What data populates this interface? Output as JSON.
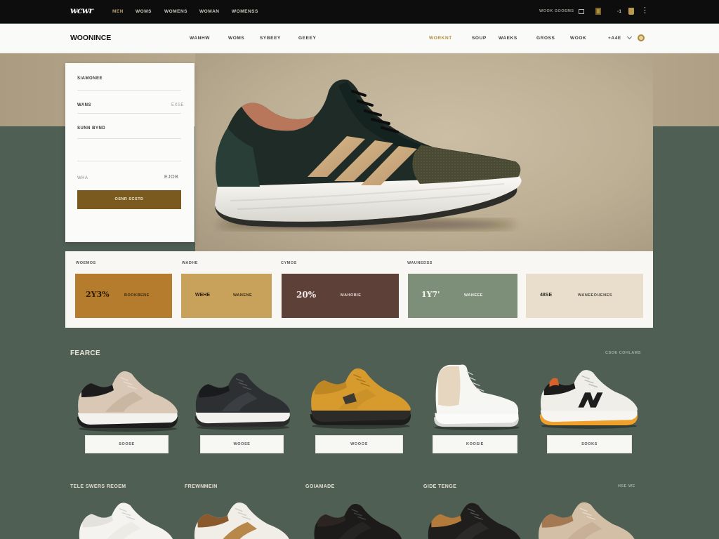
{
  "theme": {
    "topbar_bg": "#0d0d0d",
    "header_bg": "#fafaf8",
    "page_bg": "#4f5f54",
    "accent_gold": "#b08a3a",
    "form_button": "#7a5a1e"
  },
  "topbar": {
    "logo": "wcwr",
    "nav": [
      "MEN",
      "WOMS",
      "WOMENS",
      "WOMAN",
      "WOMENSS"
    ],
    "account_text": "WOOK GOOEMS",
    "cart_count": "-1",
    "icons": [
      "grid-icon",
      "tag-icon",
      "bag-icon",
      "more-icon"
    ]
  },
  "header": {
    "brand": "WOONINCE",
    "nav": [
      "WANHW",
      "WOMS",
      "SYBEEY",
      "GEEEY"
    ],
    "right_nav": [
      "WORKNT",
      "SOUP",
      "WAEKS",
      "GROSS",
      "WOOK"
    ],
    "account": "+A4E",
    "icons": [
      "chevron-down-icon",
      "user-icon"
    ]
  },
  "form": {
    "fields": [
      {
        "label": "SIAMONEE"
      },
      {
        "label": "WANS",
        "hint": "EXSE"
      },
      {
        "label": "SUNN BYND"
      },
      {
        "label": "WHA",
        "hint": "EJOB"
      }
    ],
    "button": "OSNR SCSTD"
  },
  "swatches": {
    "headers": [
      "WOEMOS",
      "WADHE",
      "CYMOS",
      "WAUNEDSS"
    ],
    "items": [
      {
        "value": "2Y3%",
        "name": "BOOKBENE",
        "color": "#b57c2d"
      },
      {
        "value": "WEHE",
        "name": "WANENE",
        "color": "#c8a15b"
      },
      {
        "value": "20%",
        "name": "MAHOBIE",
        "color": "#5d4139"
      },
      {
        "value": "1Y7'",
        "name": "WANEEE",
        "color": "#7e8f79"
      },
      {
        "value": "48SE",
        "name": "WANEEOUENES",
        "color": "#e9ddcc"
      }
    ]
  },
  "featured": {
    "title": "FEARCE",
    "link": "CSOE COHLAMS",
    "products": [
      {
        "button": "SOOSE"
      },
      {
        "button": "WOOSE"
      },
      {
        "button": "WOOOS"
      },
      {
        "button": "KOOSIE"
      },
      {
        "button": "SOOKS"
      }
    ]
  },
  "more": {
    "labels": [
      "TELE SWERS REOEM",
      "FREWNMEIN",
      "GOIAMADE",
      "GIDE TENGE"
    ],
    "link": "HSE WE"
  }
}
